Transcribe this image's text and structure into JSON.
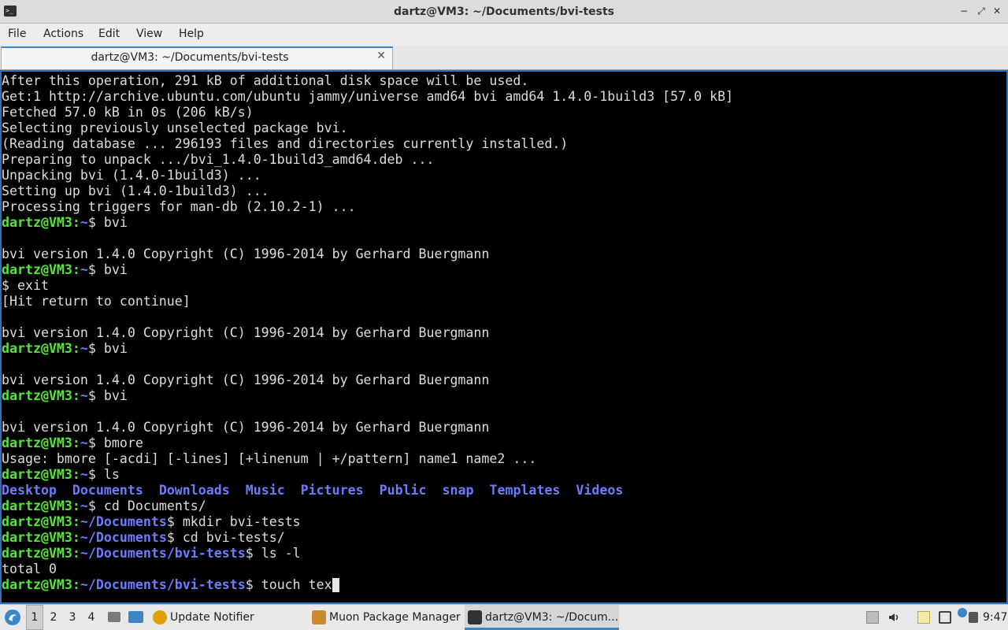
{
  "window": {
    "title": "dartz@VM3: ~/Documents/bvi-tests",
    "minimize": "−",
    "restore": "⤢",
    "close": "✕"
  },
  "menu": {
    "file": "File",
    "actions": "Actions",
    "edit": "Edit",
    "view": "View",
    "help": "Help"
  },
  "tab": {
    "label": "dartz@VM3: ~/Documents/bvi-tests",
    "close": "✕"
  },
  "terminal": {
    "lines": [
      {
        "text": "After this operation, 291 kB of additional disk space will be used."
      },
      {
        "text": "Get:1 http://archive.ubuntu.com/ubuntu jammy/universe amd64 bvi amd64 1.4.0-1build3 [57.0 kB]"
      },
      {
        "text": "Fetched 57.0 kB in 0s (206 kB/s)"
      },
      {
        "text": "Selecting previously unselected package bvi."
      },
      {
        "text": "(Reading database ... 296193 files and directories currently installed.)"
      },
      {
        "text": "Preparing to unpack .../bvi_1.4.0-1build3_amd64.deb ..."
      },
      {
        "text": "Unpacking bvi (1.4.0-1build3) ..."
      },
      {
        "text": "Setting up bvi (1.4.0-1build3) ..."
      },
      {
        "text": "Processing triggers for man-db (2.10.2-1) ..."
      },
      {
        "prompt": "dartz@VM3",
        "path": "~",
        "cmd": " bvi"
      },
      {
        "text": ""
      },
      {
        "text": "bvi version 1.4.0 Copyright (C) 1996-2014 by Gerhard Buergmann"
      },
      {
        "prompt": "dartz@VM3",
        "path": "~",
        "cmd": " bvi"
      },
      {
        "text": "$ exit"
      },
      {
        "text": "[Hit return to continue]"
      },
      {
        "text": ""
      },
      {
        "text": "bvi version 1.4.0 Copyright (C) 1996-2014 by Gerhard Buergmann"
      },
      {
        "prompt": "dartz@VM3",
        "path": "~",
        "cmd": " bvi"
      },
      {
        "text": ""
      },
      {
        "text": "bvi version 1.4.0 Copyright (C) 1996-2014 by Gerhard Buergmann"
      },
      {
        "prompt": "dartz@VM3",
        "path": "~",
        "cmd": " bvi"
      },
      {
        "text": ""
      },
      {
        "text": "bvi version 1.4.0 Copyright (C) 1996-2014 by Gerhard Buergmann"
      },
      {
        "prompt": "dartz@VM3",
        "path": "~",
        "cmd": " bmore"
      },
      {
        "text": "Usage: bmore [-acdi] [-lines] [+linenum | +/pattern] name1 name2 ..."
      },
      {
        "prompt": "dartz@VM3",
        "path": "~",
        "cmd": " ls"
      },
      {
        "dirs": [
          "Desktop",
          "Documents",
          "Downloads",
          "Music",
          "Pictures",
          "Public",
          "snap",
          "Templates",
          "Videos"
        ]
      },
      {
        "prompt": "dartz@VM3",
        "path": "~",
        "cmd": " cd Documents/"
      },
      {
        "prompt": "dartz@VM3",
        "path": "~/Documents",
        "cmd": " mkdir bvi-tests"
      },
      {
        "prompt": "dartz@VM3",
        "path": "~/Documents",
        "cmd": " cd bvi-tests/"
      },
      {
        "prompt": "dartz@VM3",
        "path": "~/Documents/bvi-tests",
        "cmd": " ls -l"
      },
      {
        "text": "total 0"
      },
      {
        "prompt": "dartz@VM3",
        "path": "~/Documents/bvi-tests",
        "cmd": " touch tex",
        "cursor": true
      }
    ]
  },
  "taskbar": {
    "desktops": [
      "1",
      "2",
      "3",
      "4"
    ],
    "active_desktop": "1",
    "tasks": [
      {
        "label": "Update Notifier",
        "icon": "update-notifier-icon"
      },
      {
        "label": "Muon Package Manager",
        "icon": "package-manager-icon"
      },
      {
        "label": "dartz@VM3: ~/Docum...",
        "icon": "terminal-icon"
      }
    ],
    "clock": "9:47"
  },
  "colors": {
    "prompt_user": "#55e63c",
    "prompt_path": "#6b7cff",
    "accent": "#3d86c6"
  }
}
